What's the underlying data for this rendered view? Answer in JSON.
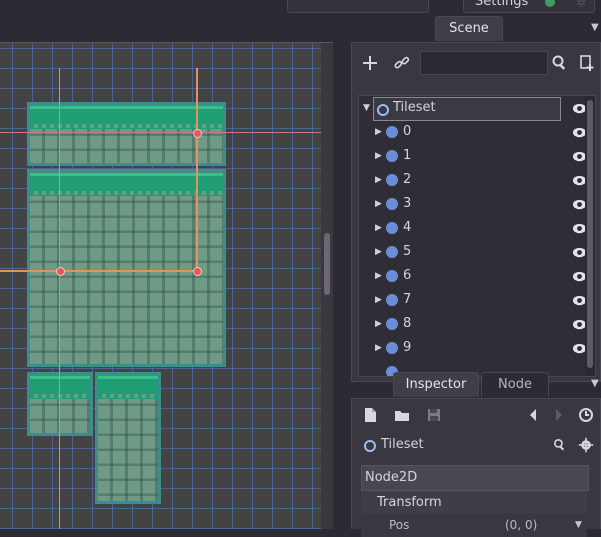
{
  "topbar": {
    "settings_label": "Settings"
  },
  "scene_dock": {
    "tab_label": "Scene",
    "search_placeholder": "",
    "root": {
      "name": "Tileset"
    },
    "children": [
      {
        "name": "0"
      },
      {
        "name": "1"
      },
      {
        "name": "2"
      },
      {
        "name": "3"
      },
      {
        "name": "4"
      },
      {
        "name": "5"
      },
      {
        "name": "6"
      },
      {
        "name": "7"
      },
      {
        "name": "8"
      },
      {
        "name": "9"
      }
    ]
  },
  "inspector_dock": {
    "tabs": [
      {
        "label": "Inspector",
        "active": true
      },
      {
        "label": "Node",
        "active": false
      }
    ],
    "object_name": "Tileset",
    "section": "Node2D",
    "subsection": "Transform",
    "property": {
      "name": "Pos",
      "value": "(0, 0)"
    }
  },
  "colors": {
    "accent_grass": "#1f9e73",
    "tile_border": "#3e8c8c",
    "selection": "#e0945a",
    "handle": "#e15b5b",
    "node_icon": "#6c8bd8"
  },
  "icons": [
    "add-node-icon",
    "link-icon",
    "search-icon",
    "scene-instance-icon",
    "visibility-eye-icon",
    "new-file-icon",
    "open-folder-icon",
    "save-icon",
    "history-back-icon",
    "history-forward-icon",
    "history-icon",
    "settings-gear-icon"
  ]
}
